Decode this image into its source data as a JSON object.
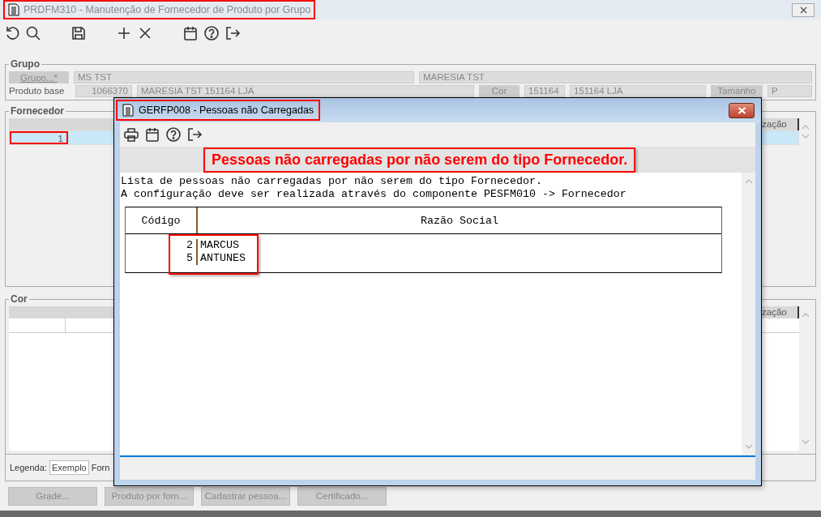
{
  "window": {
    "title": "PRDFM310 - Manutenção de Fornecedor de Produto por Grupo",
    "highlighted": true
  },
  "grupo": {
    "legend": "Grupo",
    "grupo_button": "Grupo...*",
    "grupo_code": "MS TST",
    "grupo_name": "MARESIA TST",
    "produto_label": "Produto base",
    "produto_code": "1066370",
    "produto_name": "MARESIA TST 151164 LJA",
    "cor_label": "Cor",
    "cor_code": "151164",
    "cor_name": "151164 LJA",
    "tamanho_label": "Tamanho",
    "tamanho_value": "P"
  },
  "fornecedor": {
    "legend": "Fornecedor",
    "column_header": "zação",
    "rows": [
      {
        "cell": "1",
        "selected": true,
        "highlighted": true
      }
    ]
  },
  "cor": {
    "legend": "Cor",
    "column_header": "zação"
  },
  "legenda": {
    "label": "Legenda:",
    "sample": "Exemplo",
    "text": "Forn"
  },
  "buttons": [
    {
      "label": "Grade...",
      "disabled": true
    },
    {
      "label": "Produto por forn...",
      "disabled": true
    },
    {
      "label": "Cadastrar pessoa...",
      "disabled": true
    },
    {
      "label": "Certificado...",
      "disabled": true
    }
  ],
  "dialog": {
    "title": "GERFP008 - Pessoas não Carregadas",
    "title_highlighted": true,
    "heading": "Pessoas não carregadas por não serem do tipo Fornecedor.",
    "heading_highlighted": true,
    "message_lines": [
      "Lista de pessoas não carregadas por não serem do tipo Fornecedor.",
      "A configuração deve ser realizada através do componente PESFM010 -> Fornecedor"
    ],
    "columns": [
      "Código",
      "Razão Social"
    ],
    "rows": [
      {
        "code": "2",
        "name": "MARCUS"
      },
      {
        "code": "5",
        "name": "ANTUNES"
      }
    ],
    "rows_highlighted": true
  }
}
